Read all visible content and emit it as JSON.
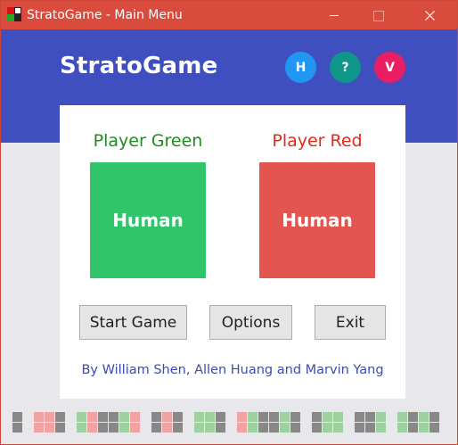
{
  "window": {
    "title": "StratoGame - Main Menu",
    "icon": "strato-board-icon",
    "controls": [
      "minimize-icon",
      "maximize-icon",
      "close-icon"
    ]
  },
  "header": {
    "brand": "StratoGame",
    "circle_buttons": [
      {
        "label": "H",
        "color": "#2196f3"
      },
      {
        "label": "?",
        "color": "#0f968a"
      },
      {
        "label": "V",
        "color": "#e91e63"
      }
    ]
  },
  "players": {
    "green": {
      "label": "Player Green",
      "type": "Human",
      "color": "#31c56b"
    },
    "red": {
      "label": "Player Red",
      "type": "Human",
      "color": "#e55550"
    }
  },
  "buttons": {
    "start": "Start Game",
    "options": "Options",
    "exit": "Exit"
  },
  "credits": "By William Shen, Allen Huang and Marvin Yang",
  "colors": {
    "titlebar": "#d84b3d",
    "header": "#3f4fbf",
    "background": "#e8e8ec",
    "pattern_gray": "#888888",
    "pattern_red": "#f2a2a2",
    "pattern_green": "#9fd09f"
  }
}
